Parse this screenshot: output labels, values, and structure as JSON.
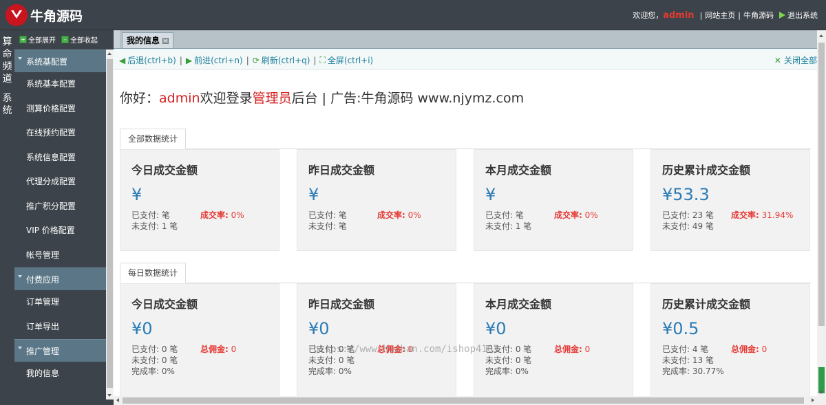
{
  "header": {
    "logo_text": "牛角源码",
    "welcome": "欢迎您，",
    "user": "admin",
    "links": [
      "网站主页",
      "牛角源码"
    ],
    "logout": "退出系统"
  },
  "leftstrip": {
    "groups": [
      "算命频道",
      "系统"
    ]
  },
  "sidebar": {
    "expand_all": "全部展开",
    "collapse_all": "全部收起",
    "menu": [
      {
        "type": "head",
        "label": "系统基配置"
      },
      {
        "type": "item",
        "label": "系统基本配置"
      },
      {
        "type": "item",
        "label": "测算价格配置"
      },
      {
        "type": "item",
        "label": "在线预约配置"
      },
      {
        "type": "item",
        "label": "系统信息配置"
      },
      {
        "type": "item",
        "label": "代理分成配置"
      },
      {
        "type": "item",
        "label": "推广积分配置"
      },
      {
        "type": "item",
        "label": "VIP 价格配置"
      },
      {
        "type": "item",
        "label": "帐号管理"
      },
      {
        "type": "head",
        "label": "付费应用"
      },
      {
        "type": "item",
        "label": "订单管理"
      },
      {
        "type": "item",
        "label": "订单导出"
      },
      {
        "type": "head",
        "label": "推广管理"
      },
      {
        "type": "item",
        "label": "我的信息"
      }
    ]
  },
  "tabs": {
    "active": "我的信息"
  },
  "toolbar": {
    "back": "后退(ctrl+b)",
    "forward": "前进(ctrl+n)",
    "refresh": "刷新(ctrl+q)",
    "fullscreen": "全屏(ctrl+i)",
    "close_all": "关闭全部"
  },
  "greeting": {
    "hello": "你好：",
    "user": "admin",
    "welcome": "欢迎登录",
    "role": "管理员",
    "rest": "后台 | 广告:牛角源码 www.njymz.com"
  },
  "sections": [
    {
      "tab": "全部数据统计",
      "cards": [
        {
          "title": "今日成交金额",
          "amount": "¥",
          "lines": [
            "已支付: 笔",
            "未支付: 1 笔"
          ],
          "ratio_label": "成交率:",
          "ratio_value": " 0%"
        },
        {
          "title": "昨日成交金额",
          "amount": "¥",
          "lines": [
            "已支付: 笔",
            "未支付: 笔"
          ],
          "ratio_label": "成交率:",
          "ratio_value": " 0%"
        },
        {
          "title": "本月成交金额",
          "amount": "¥",
          "lines": [
            "已支付: 笔",
            "未支付: 1 笔"
          ],
          "ratio_label": "成交率:",
          "ratio_value": " 0%"
        },
        {
          "title": "历史累计成交金额",
          "amount": "¥53.3",
          "lines": [
            "已支付: 23 笔",
            "未支付: 49 笔"
          ],
          "ratio_label": "成交率:",
          "ratio_value": " 31.94%"
        }
      ]
    },
    {
      "tab": "每日数据统计",
      "cards": [
        {
          "title": "今日成交金额",
          "amount": "¥0",
          "lines": [
            "已支付: 0 笔",
            "未支付: 0 笔",
            "完成率: 0%"
          ],
          "ratio_label": "总佣金:",
          "ratio_value": " 0"
        },
        {
          "title": "昨日成交金额",
          "amount": "¥0",
          "lines": [
            "已支付: 0 笔",
            "未支付: 0 笔",
            "完成率: 0%"
          ],
          "ratio_label": "总佣金:",
          "ratio_value": " 0"
        },
        {
          "title": "本月成交金额",
          "amount": "¥0",
          "lines": [
            "已支付: 0 笔",
            "未支付: 0 笔",
            "完成率: 0%"
          ],
          "ratio_label": "总佣金:",
          "ratio_value": " 0"
        },
        {
          "title": "历史累计成交金额",
          "amount": "¥0.5",
          "lines": [
            "已支付: 4 笔",
            "未支付: 13 笔",
            "完成率: 30.77%"
          ],
          "ratio_label": "总佣金:",
          "ratio_value": " 0"
        }
      ]
    }
  ],
  "watermark": "https://www.huzhan.com/ishop4103"
}
